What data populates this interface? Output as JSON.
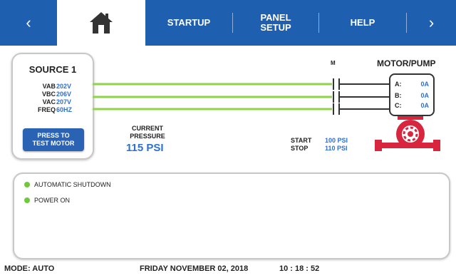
{
  "nav": {
    "back": "‹",
    "startup": "STARTUP",
    "panel_setup_line1": "PANEL",
    "panel_setup_line2": "SETUP",
    "help": "HELP",
    "forward": "›"
  },
  "source": {
    "title": "SOURCE 1",
    "readings": [
      {
        "label": "VAB",
        "value": "202V"
      },
      {
        "label": "VBC",
        "value": "206V"
      },
      {
        "label": "VAC",
        "value": "207V"
      },
      {
        "label": "FREQ",
        "value": "60HZ"
      }
    ],
    "test_button_line1": "PRESS TO",
    "test_button_line2": "TEST MOTOR"
  },
  "pressure": {
    "label_line1": "CURRENT",
    "label_line2": "PRESSURE",
    "value": "115 PSI",
    "start_label": "START",
    "start_value": "100 PSI",
    "stop_label": "STOP",
    "stop_value": "110 PSI"
  },
  "motor": {
    "contactor_label": "M",
    "title": "MOTOR/PUMP",
    "phases": [
      {
        "label": "A:",
        "amps": "0A"
      },
      {
        "label": "B:",
        "amps": "0A"
      },
      {
        "label": "C:",
        "amps": "0A"
      }
    ]
  },
  "status": {
    "items": [
      "AUTOMATIC SHUTDOWN",
      "POWER ON"
    ],
    "indicator_color": "#6fc83e"
  },
  "footer": {
    "mode": "MODE: AUTO",
    "date": "FRIDAY NOVEMBER 02, 2018",
    "time": "10 : 18 : 52"
  },
  "colors": {
    "nav_blue": "#1f5fb0",
    "value_blue": "#2e6fd0",
    "line_green": "#8ed34a",
    "pump_red": "#d8263f"
  }
}
